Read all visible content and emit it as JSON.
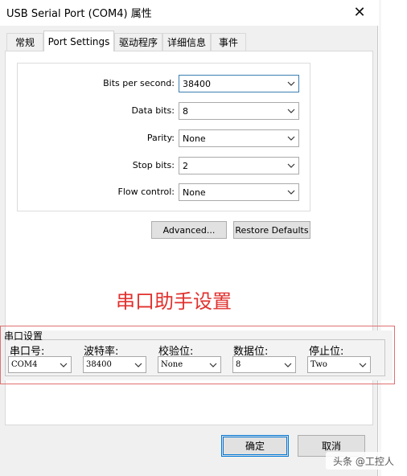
{
  "window": {
    "title": "USB Serial Port (COM4) 属性",
    "close_glyph": "✕"
  },
  "tabs": [
    {
      "label": "常规",
      "active": false
    },
    {
      "label": "Port Settings",
      "active": true
    },
    {
      "label": "驱动程序",
      "active": false
    },
    {
      "label": "详细信息",
      "active": false
    },
    {
      "label": "事件",
      "active": false
    }
  ],
  "port_settings": {
    "fields": [
      {
        "label": "Bits per second:",
        "value": "38400"
      },
      {
        "label": "Data bits:",
        "value": "8"
      },
      {
        "label": "Parity:",
        "value": "None"
      },
      {
        "label": "Stop bits:",
        "value": "2"
      },
      {
        "label": "Flow control:",
        "value": "None"
      }
    ],
    "advanced_label": "Advanced...",
    "restore_label": "Restore Defaults"
  },
  "annotation": {
    "heading": "串口助手设置",
    "heading_color": "#e0312e",
    "section_title": "串口设置",
    "fields": [
      {
        "label": "串口号:",
        "value": "COM4"
      },
      {
        "label": "波特率:",
        "value": "38400"
      },
      {
        "label": "校验位:",
        "value": "None"
      },
      {
        "label": "数据位:",
        "value": "8"
      },
      {
        "label": "停止位:",
        "value": "Two"
      }
    ]
  },
  "buttons": {
    "ok": "确定",
    "cancel": "取消"
  },
  "watermark": "头条 @工控人",
  "icons": {
    "dropdown": "chevron-down-icon",
    "close": "close-icon"
  }
}
